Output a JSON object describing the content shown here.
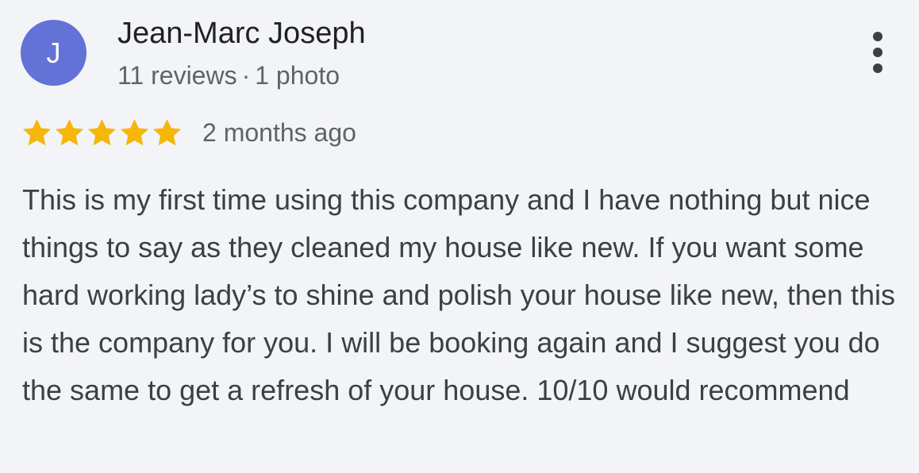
{
  "review": {
    "author": {
      "initial": "J",
      "name": "Jean-Marc Joseph",
      "reviews_count": "11 reviews",
      "separator": "·",
      "photos_count": "1 photo",
      "avatar_color": "#6272d6"
    },
    "rating": {
      "value": 5,
      "max": 5,
      "star_color": "#f6b60a"
    },
    "date": "2 months ago",
    "text": "This is my first time using this company and I have nothing but nice things to say as they cleaned my house like new. If you want some hard working lady’s to shine and polish your house like new, then this is the company for you. I will be booking again and I suggest you do the same to get a refresh of your house. 10/10 would recommend",
    "more_icon": "more-vert-icon"
  }
}
